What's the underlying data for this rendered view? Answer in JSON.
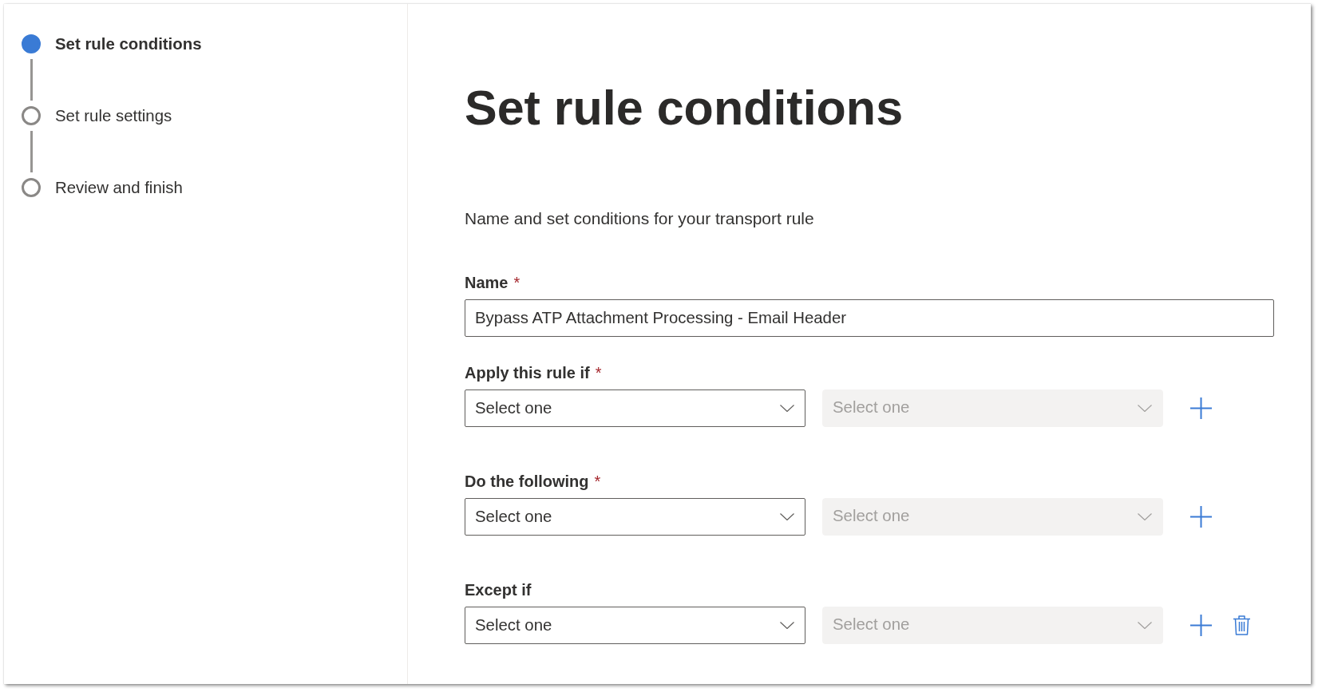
{
  "steps": [
    {
      "label": "Set rule conditions",
      "selected": true
    },
    {
      "label": "Set rule settings",
      "selected": false
    },
    {
      "label": "Review and finish",
      "selected": false
    }
  ],
  "title": "Set rule conditions",
  "description": "Name and set conditions for your transport rule",
  "name_field": {
    "label": "Name",
    "required_mark": "*",
    "value": "Bypass ATP Attachment Processing - Email Header"
  },
  "condition_groups": [
    {
      "label": "Apply this rule if",
      "required_mark": "*",
      "dropdowns": [
        {
          "placeholder": "Select one",
          "disabled": false
        },
        {
          "placeholder": "Select one",
          "disabled": true
        }
      ],
      "deletable": false
    },
    {
      "label": "Do the following",
      "required_mark": "*",
      "dropdowns": [
        {
          "placeholder": "Select one",
          "disabled": false
        },
        {
          "placeholder": "Select one",
          "disabled": true
        }
      ],
      "deletable": false
    },
    {
      "label": "Except if",
      "dropdowns": [
        {
          "placeholder": "Select one",
          "disabled": false
        },
        {
          "placeholder": "Select one",
          "disabled": true
        }
      ],
      "deletable": true
    }
  ]
}
